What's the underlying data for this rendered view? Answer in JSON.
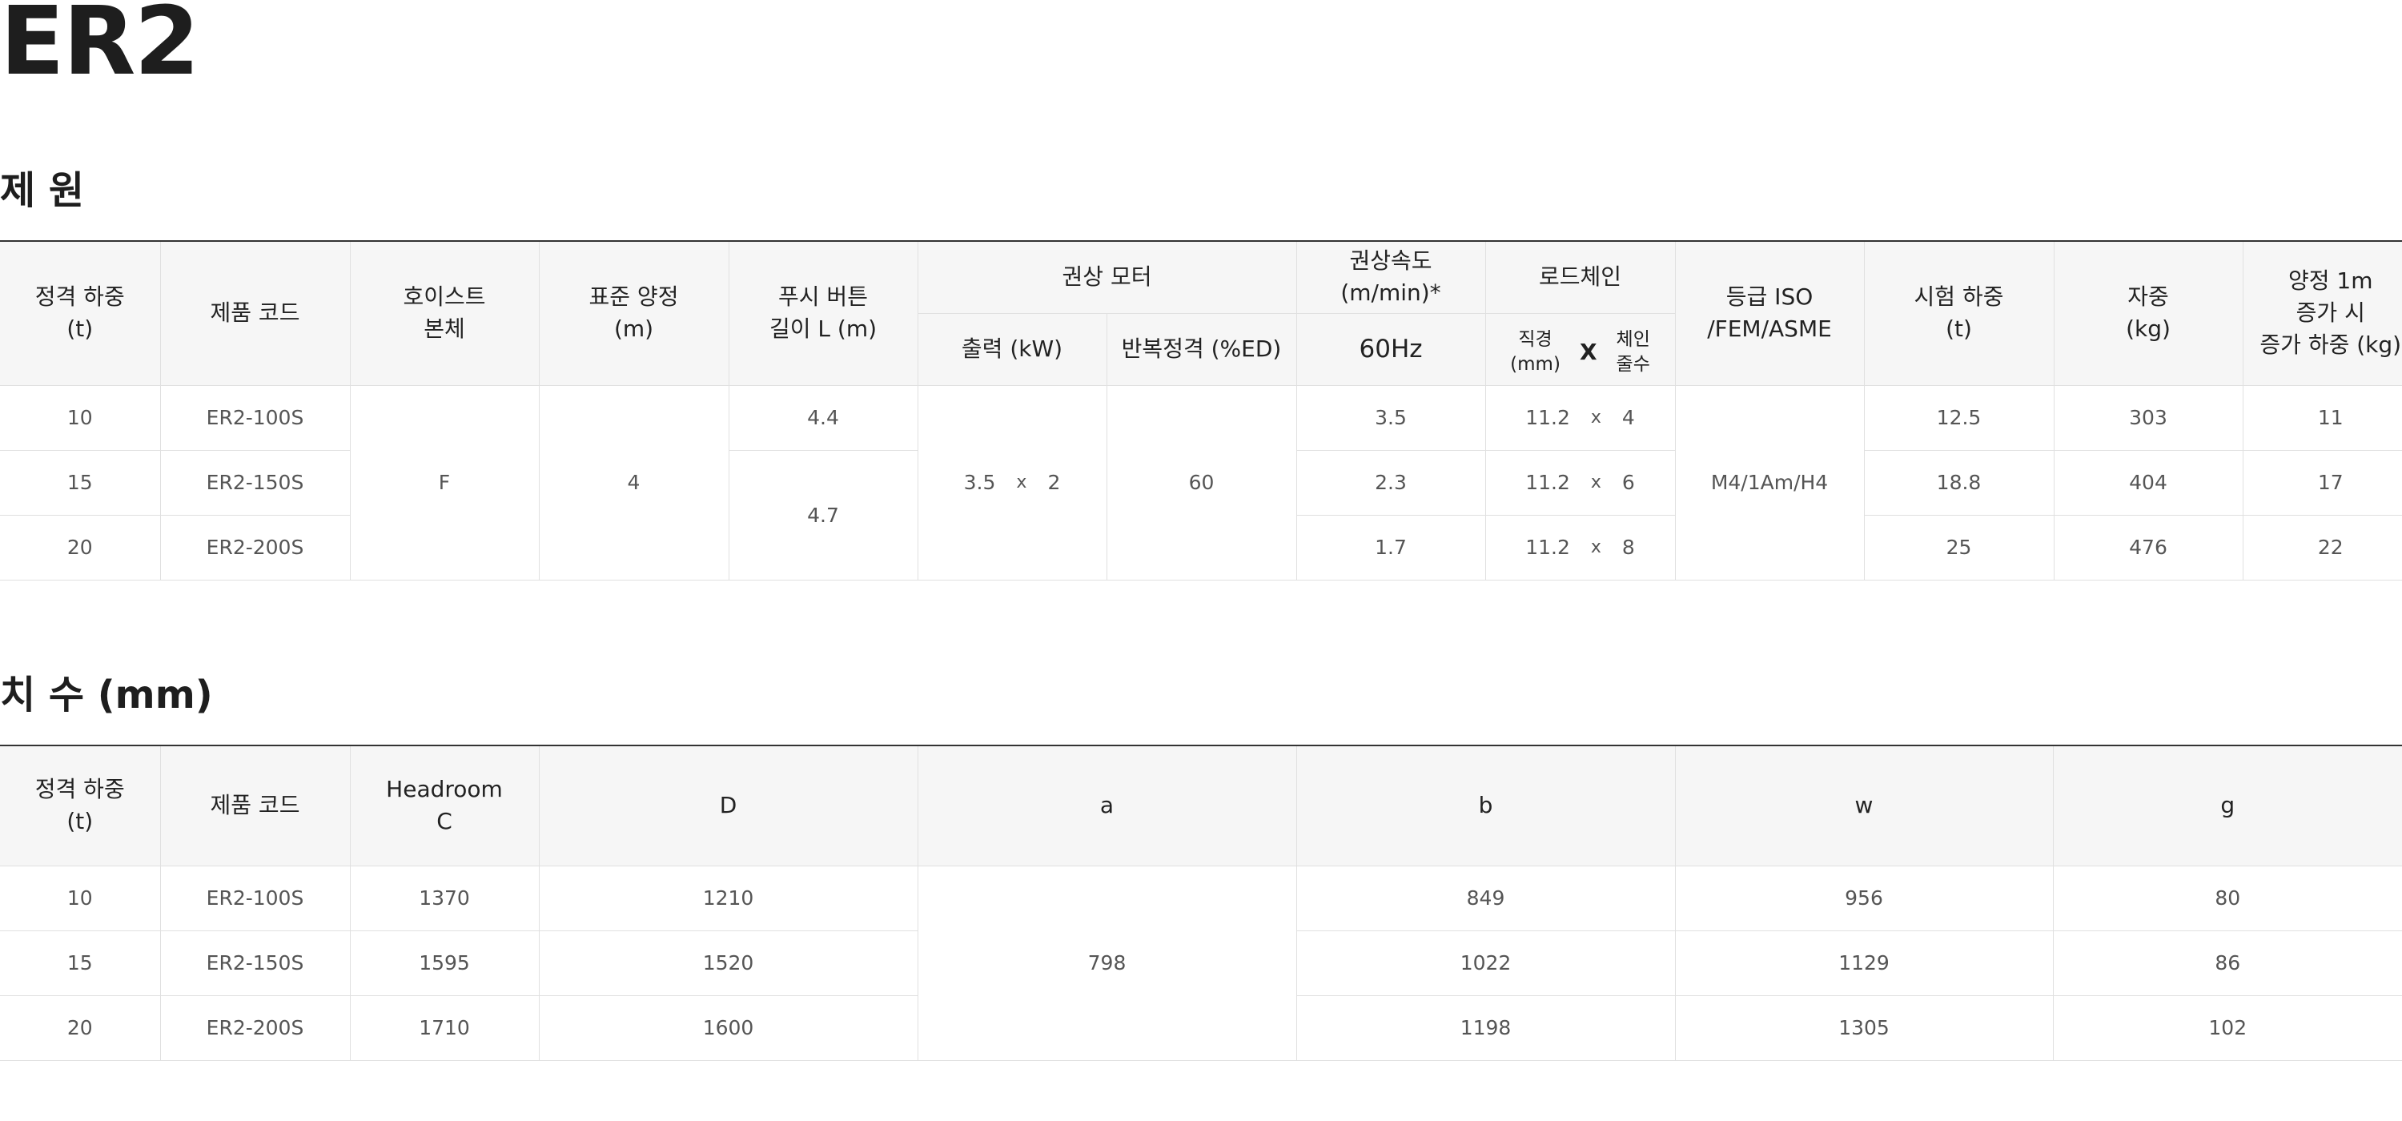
{
  "title": "ER2",
  "spec": {
    "heading": "제 원",
    "headers": {
      "rated_load": [
        "정격 하중",
        "(t)"
      ],
      "product_code": "제품 코드",
      "hoist_body": [
        "호이스트",
        "본체"
      ],
      "std_lift": [
        "표준 양정",
        "(m)"
      ],
      "push_button": [
        "푸시 버튼",
        "길이 L (m)"
      ],
      "motor": "권상 모터",
      "motor_output": "출력 (kW)",
      "motor_duty": "반복정격 (%ED)",
      "speed": "권상속도 (m/min)*",
      "speed_hz": "60Hz",
      "chain": "로드체인",
      "chain_dia": [
        "직경",
        "(mm)"
      ],
      "chain_x": "X",
      "chain_falls": [
        "체인",
        "줄수"
      ],
      "grade": [
        "등급 ISO",
        "/FEM/ASME"
      ],
      "test_load": [
        "시험 하중",
        "(t)"
      ],
      "weight": [
        "자중",
        "(kg)"
      ],
      "extra_weight": [
        "양정 1m",
        "증가 시",
        "증가 하중 (kg)"
      ]
    },
    "shared": {
      "hoist_body": "F",
      "std_lift": "4",
      "motor_kw": "3.5",
      "motor_x": "x",
      "motor_count": "2",
      "duty": "60",
      "grade": "M4/1Am/H4"
    },
    "push_button_values": [
      "4.4",
      "4.7"
    ],
    "rows": [
      {
        "rated": "10",
        "code": "ER2-100S",
        "speed": "3.5",
        "chain_dia": "11.2",
        "chain_x": "x",
        "falls": "4",
        "test": "12.5",
        "weight": "303",
        "extra": "11"
      },
      {
        "rated": "15",
        "code": "ER2-150S",
        "speed": "2.3",
        "chain_dia": "11.2",
        "chain_x": "x",
        "falls": "6",
        "test": "18.8",
        "weight": "404",
        "extra": "17"
      },
      {
        "rated": "20",
        "code": "ER2-200S",
        "speed": "1.7",
        "chain_dia": "11.2",
        "chain_x": "x",
        "falls": "8",
        "test": "25",
        "weight": "476",
        "extra": "22"
      }
    ]
  },
  "dims": {
    "heading": "치 수 (mm)",
    "headers": {
      "rated_load": [
        "정격 하중",
        "(t)"
      ],
      "product_code": "제품 코드",
      "headroom": [
        "Headroom",
        "C"
      ],
      "d": "D",
      "a": "a",
      "b": "b",
      "w": "w",
      "g": "g"
    },
    "a_value": "798",
    "rows": [
      {
        "rated": "10",
        "code": "ER2-100S",
        "c": "1370",
        "d": "1210",
        "b": "849",
        "w": "956",
        "g": "80"
      },
      {
        "rated": "15",
        "code": "ER2-150S",
        "c": "1595",
        "d": "1520",
        "b": "1022",
        "w": "1129",
        "g": "86"
      },
      {
        "rated": "20",
        "code": "ER2-200S",
        "c": "1710",
        "d": "1600",
        "b": "1198",
        "w": "1305",
        "g": "102"
      }
    ]
  }
}
